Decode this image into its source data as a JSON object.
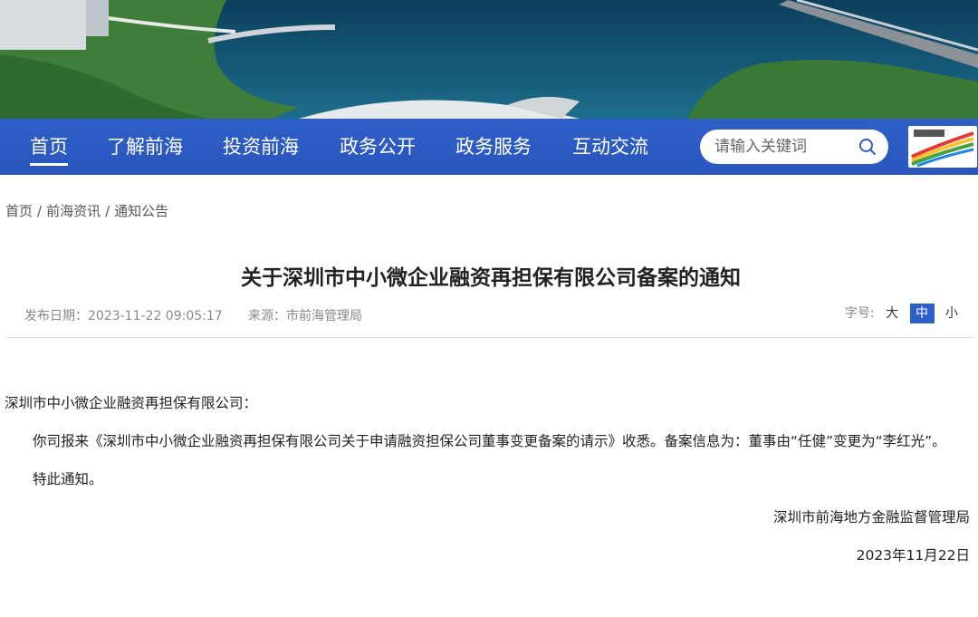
{
  "nav": {
    "items": [
      {
        "label": "首页",
        "active": true
      },
      {
        "label": "了解前海"
      },
      {
        "label": "投资前海"
      },
      {
        "label": "政务公开"
      },
      {
        "label": "政务服务"
      },
      {
        "label": "互动交流"
      }
    ]
  },
  "search": {
    "placeholder": "请输入关键词",
    "icon": "search-icon"
  },
  "logo": {
    "icon": "qianhai-logo"
  },
  "breadcrumb": [
    "首页",
    "前海资讯",
    "通知公告"
  ],
  "breadcrumb_separator": "/",
  "article": {
    "title": "关于深圳市中小微企业融资再担保有限公司备案的通知",
    "publish_date": "发布日期：2023-11-22 09:05:17",
    "source": "来源：市前海管理局",
    "font_size_label": "字号:",
    "font_sizes": [
      "大",
      "中",
      "小"
    ],
    "salutation": "深圳市中小微企业融资再担保有限公司：",
    "body": "你司报来《深圳市中小微企业融资再担保有限公司关于申请融资担保公司董事变更备案的请示》收悉。备案信息为：董事由“任健”变更为“李红光”。",
    "closing": "特此通知。",
    "signature": "深圳市前海地方金融监督管理局",
    "date": "2023年11月22日"
  },
  "colors": {
    "nav_bg": "#2e5fc8",
    "active_font_btn": "#2e5fc8"
  }
}
